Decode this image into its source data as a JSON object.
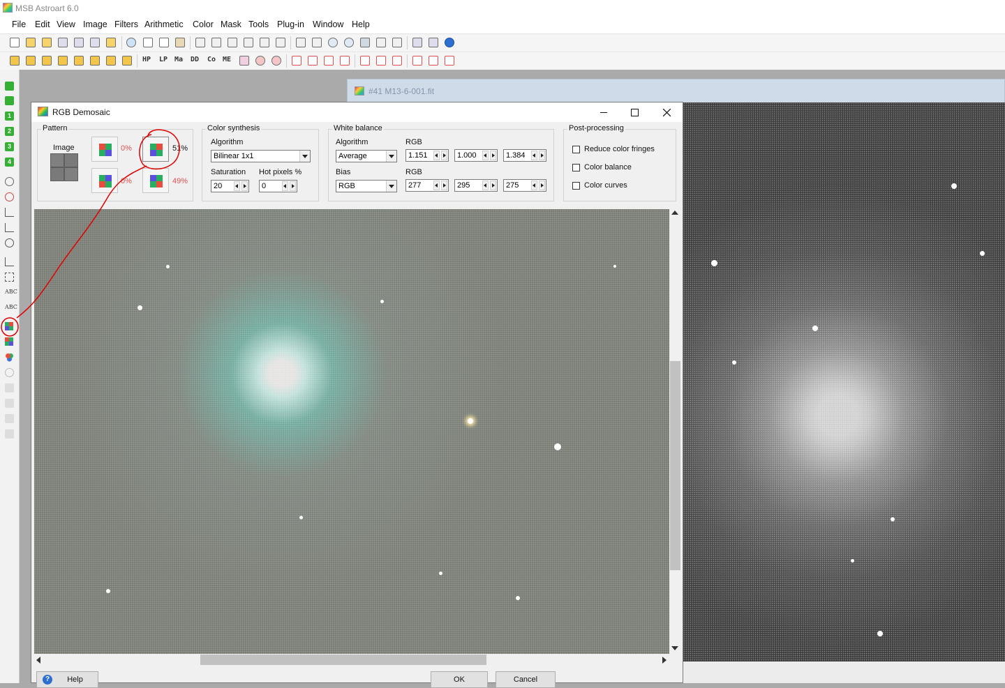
{
  "app": {
    "title": "MSB Astroart 6.0"
  },
  "menu": [
    "File",
    "Edit",
    "View",
    "Image",
    "Filters",
    "Arithmetic",
    "Color",
    "Mask",
    "Tools",
    "Plug-in",
    "Window",
    "Help"
  ],
  "toolbar2_labels": [
    "HP",
    "LP",
    "Ma",
    "DD",
    "Co",
    "ME"
  ],
  "left_toolbar_labels": [
    "1",
    "2",
    "3",
    "4"
  ],
  "left_toolbar_abc": "ABC",
  "image_window": {
    "title": "#41 M13-6-001.fit"
  },
  "dialog": {
    "title": "RGB Demosaic",
    "pattern": {
      "legend": "Pattern",
      "image_label": "Image",
      "percentages": [
        "0%",
        "51%",
        "0%",
        "49%"
      ],
      "colors": {
        "p1": [
          "#e74c3c",
          "#27ae60",
          "#27ae60",
          "#5b4fe0"
        ],
        "p2": [
          "#27ae60",
          "#e74c3c",
          "#5b4fe0",
          "#27ae60"
        ],
        "p3": [
          "#27ae60",
          "#5b4fe0",
          "#e74c3c",
          "#27ae60"
        ],
        "p4": [
          "#5b4fe0",
          "#27ae60",
          "#27ae60",
          "#e74c3c"
        ]
      }
    },
    "color_synthesis": {
      "legend": "Color synthesis",
      "algorithm_label": "Algorithm",
      "algorithm_value": "Bilinear 1x1",
      "saturation_label": "Saturation",
      "saturation_value": "20",
      "hot_pixels_label": "Hot pixels %",
      "hot_pixels_value": "0"
    },
    "white_balance": {
      "legend": "White balance",
      "algorithm_label": "Algorithm",
      "algorithm_value": "Average",
      "rgb_label": "RGB",
      "rgb_values": [
        "1.151",
        "1.000",
        "1.384"
      ],
      "bias_label": "Bias",
      "bias_value": "RGB",
      "rgb2_label": "RGB",
      "bias_values": [
        "277",
        "295",
        "275"
      ]
    },
    "post_processing": {
      "legend": "Post-processing",
      "options": [
        "Reduce color fringes",
        "Color balance",
        "Color curves"
      ]
    },
    "buttons": {
      "help": "Help",
      "ok": "OK",
      "cancel": "Cancel"
    }
  },
  "colors": {
    "annotation": "#e00000",
    "pct_highlight": "#e05050"
  }
}
